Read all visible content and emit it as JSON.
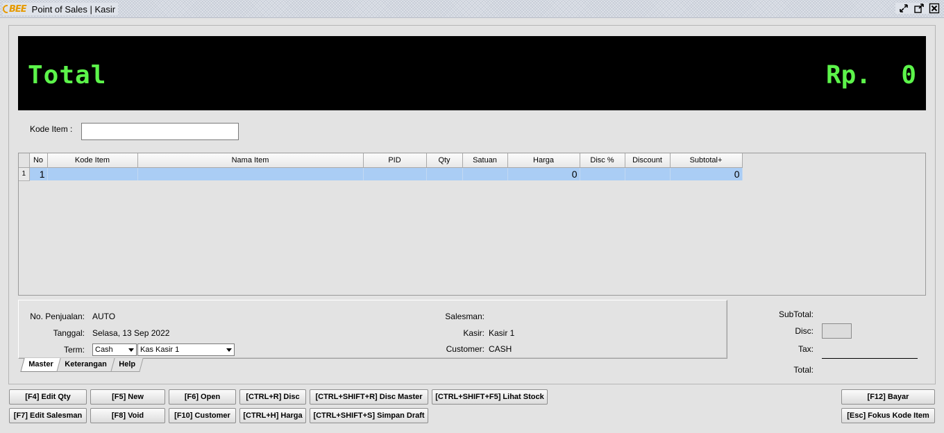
{
  "window": {
    "logo_text": "BEE",
    "title": "Point of Sales | Kasir",
    "controls": [
      "minimize-icon",
      "restore-icon",
      "close-icon"
    ]
  },
  "display": {
    "total_label": "Total",
    "total_value": "Rp.  0",
    "bg_color": "#000000",
    "text_color": "#5cf44a"
  },
  "kode_item": {
    "label": "Kode Item :",
    "value": ""
  },
  "grid": {
    "columns": [
      "No",
      "Kode Item",
      "Nama Item",
      "PID",
      "Qty",
      "Satuan",
      "Harga",
      "Disc %",
      "Discount",
      "Subtotal+"
    ],
    "rows": [
      {
        "row_header": "1",
        "no": "1",
        "kode_item": "",
        "nama_item": "",
        "pid": "",
        "qty": "",
        "satuan": "",
        "harga": "0",
        "disc_pct": "",
        "discount": "",
        "subtotal": "0"
      }
    ],
    "selected_row_color": "#aacdf5"
  },
  "master": {
    "no_penjualan_label": "No. Penjualan:",
    "no_penjualan_value": "AUTO",
    "tanggal_label": "Tanggal:",
    "tanggal_value": "Selasa, 13 Sep 2022",
    "term_label": "Term:",
    "term_value": "Cash",
    "kas_value": "Kas Kasir 1",
    "salesman_label": "Salesman:",
    "salesman_value": "",
    "kasir_label": "Kasir:",
    "kasir_value": "Kasir 1",
    "customer_label": "Customer:",
    "customer_value": "CASH"
  },
  "tabs": [
    "Master",
    "Keterangan",
    "Help"
  ],
  "active_tab": "Master",
  "summary": {
    "subtotal_label": "SubTotal:",
    "disc_label": "Disc:",
    "tax_label": "Tax:",
    "total_label": "Total:"
  },
  "buttons": {
    "edit_qty": "[F4] Edit Qty",
    "new": "[F5] New",
    "open": "[F6] Open",
    "disc": "[CTRL+R] Disc",
    "disc_master": "[CTRL+SHIFT+R] Disc Master",
    "lihat_stock": "[CTRL+SHIFT+F5] Lihat Stock",
    "bayar": "[F12] Bayar",
    "edit_salesman": "[F7] Edit Salesman",
    "void": "[F8] Void",
    "customer": "[F10] Customer",
    "harga": "[CTRL+H] Harga",
    "simpan_draft": "[CTRL+SHIFT+S] Simpan Draft",
    "fokus_kode_item": "[Esc] Fokus Kode Item"
  }
}
